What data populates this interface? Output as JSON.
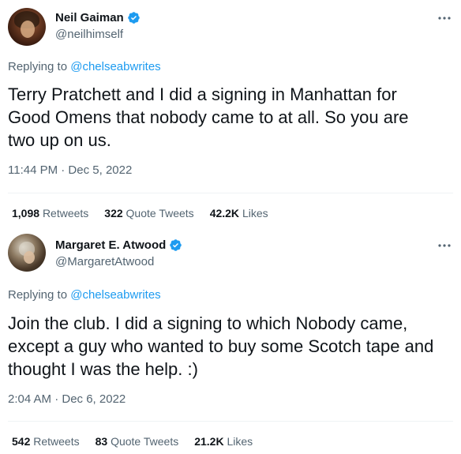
{
  "tweets": [
    {
      "name": "Neil Gaiman",
      "handle": "@neilhimself",
      "replying_prefix": "Replying to ",
      "replying_to": "@chelseabwrites",
      "text": "Terry Pratchett and I did a signing in Manhattan for\nGood Omens that nobody came to at all.  So you are\ntwo up on us.",
      "timestamp": "11:44 PM · Dec 5, 2022",
      "stats": {
        "retweets_count": "1,098",
        "retweets_label": "Retweets",
        "quotes_count": "322",
        "quotes_label": "Quote Tweets",
        "likes_count": "42.2K",
        "likes_label": "Likes"
      }
    },
    {
      "name": "Margaret E. Atwood",
      "handle": "@MargaretAtwood",
      "replying_prefix": "Replying to ",
      "replying_to": "@chelseabwrites",
      "text": "Join the club. I did a signing to which Nobody came,\nexcept a guy who wanted to buy some Scotch tape and\nthought I was the help. :)",
      "timestamp": "2:04 AM · Dec 6, 2022",
      "stats": {
        "retweets_count": "542",
        "retweets_label": "Retweets",
        "quotes_count": "83",
        "quotes_label": "Quote Tweets",
        "likes_count": "21.2K",
        "likes_label": "Likes"
      }
    }
  ],
  "icons": {
    "verified": "verified-badge-icon",
    "more": "more-horizontal-icon"
  },
  "colors": {
    "link": "#1d9bf0",
    "secondary_text": "#536471",
    "primary_text": "#0f1419",
    "verified": "#1d9bf0"
  }
}
